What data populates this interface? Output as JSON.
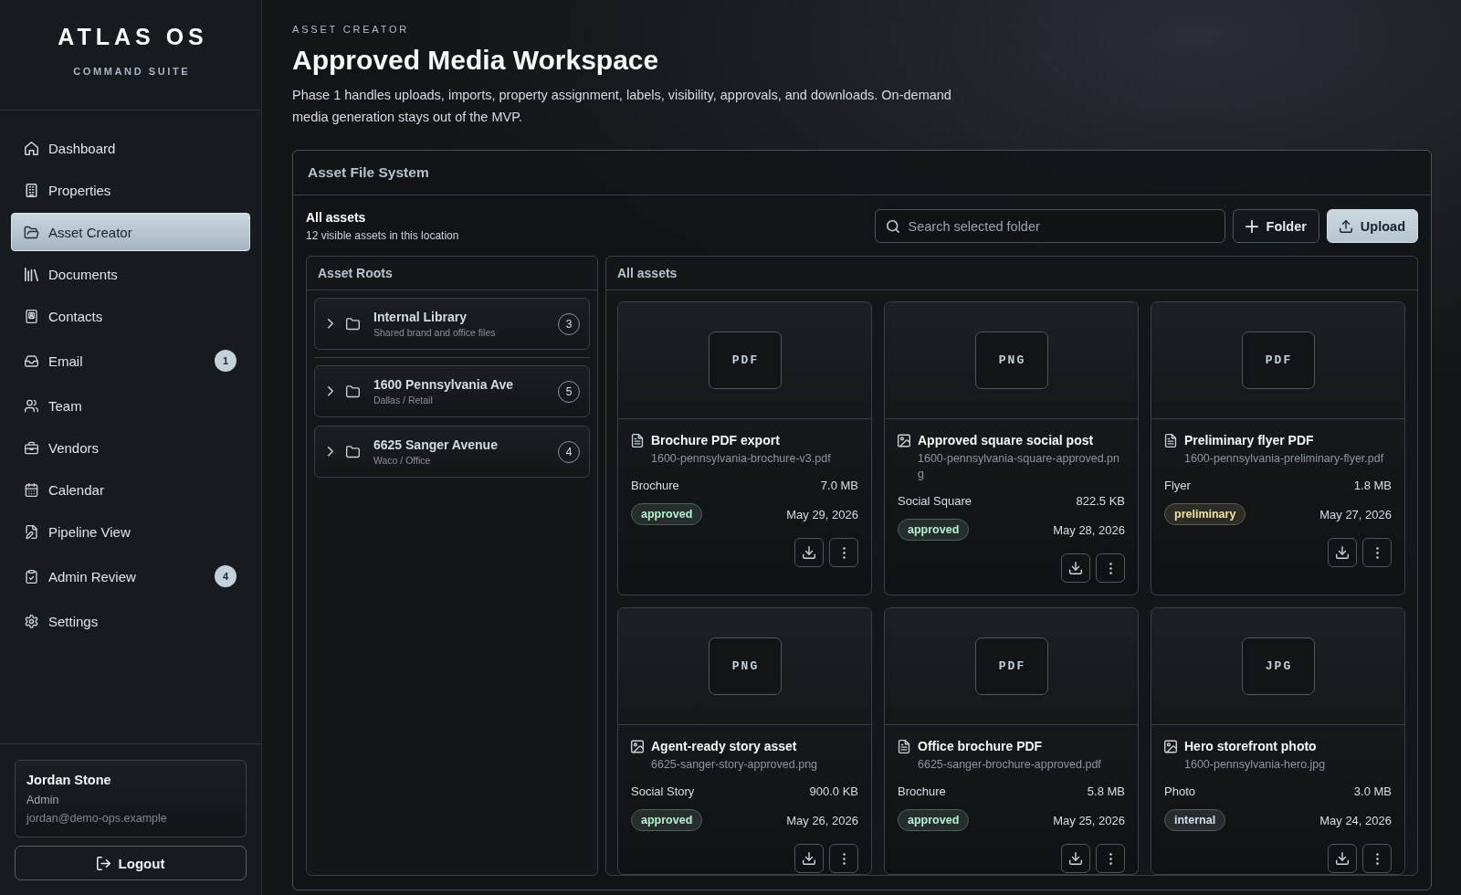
{
  "sidebar": {
    "brand": {
      "title": "ATLAS OS",
      "subtitle": "COMMAND SUITE"
    },
    "nav_items": [
      {
        "label": "Dashboard",
        "selected": false
      },
      {
        "label": "Properties",
        "selected": false
      },
      {
        "label": "Asset Creator",
        "selected": true
      },
      {
        "label": "Documents",
        "selected": false
      },
      {
        "label": "Contacts",
        "selected": false
      },
      {
        "label": "Email",
        "selected": false,
        "badge": "1"
      },
      {
        "label": "Team",
        "selected": false
      },
      {
        "label": "Vendors",
        "selected": false
      },
      {
        "label": "Calendar",
        "selected": false
      },
      {
        "label": "Pipeline View",
        "selected": false
      },
      {
        "label": "Admin Review",
        "selected": false,
        "badge": "4"
      },
      {
        "label": "Settings",
        "selected": false
      }
    ],
    "user": {
      "name": "Jordan Stone",
      "role": "Admin",
      "email": "jordan@demo-ops.example"
    },
    "logout_button": {
      "label": "Logout"
    }
  },
  "header": {
    "eyebrow": "ASSET CREATOR",
    "title": "Approved Media Workspace",
    "description": "Phase 1 handles uploads, imports, property assignment, labels, visibility, approvals, and downloads. On-demand media generation stays out of the MVP."
  },
  "file_system": {
    "title": "Asset File System",
    "location": {
      "title": "All assets",
      "subtitle": "12 visible assets in this location"
    },
    "search": {
      "placeholder": "Search selected folder"
    },
    "buttons": [
      {
        "label": "Folder",
        "kind": "create",
        "primary": false
      },
      {
        "label": "Upload",
        "kind": "upload",
        "primary": true
      }
    ],
    "roots": {
      "title": "Asset Roots",
      "groups": [
        {
          "items": [
            {
              "name": "Internal Library",
              "subtitle": "Shared brand and office files",
              "count": "3",
              "expanded": false
            }
          ]
        },
        {
          "items": [
            {
              "name": "1600 Pennsylvania Ave",
              "subtitle": "Dallas / Retail",
              "count": "5",
              "expanded": false
            },
            {
              "name": "6625 Sanger Avenue",
              "subtitle": "Waco / Office",
              "count": "4",
              "expanded": false
            }
          ]
        }
      ]
    },
    "assets": {
      "title": "All assets",
      "items": [
        {
          "format": "PDF",
          "kind": "document",
          "title": "Brochure PDF export",
          "filename": "1600-pennsylvania-brochure-v3.pdf",
          "category": "Brochure",
          "size": "7.0 MB",
          "status": {
            "label": "approved",
            "color": "#b6eed0"
          },
          "date": "May 29, 2026"
        },
        {
          "format": "PNG",
          "kind": "image",
          "title": "Approved square social post",
          "filename": "1600-pennsylvania-square-approved.png",
          "category": "Social Square",
          "size": "822.5 KB",
          "status": {
            "label": "approved",
            "color": "#b6eed0"
          },
          "date": "May 28, 2026"
        },
        {
          "format": "PDF",
          "kind": "document",
          "title": "Preliminary flyer PDF",
          "filename": "1600-pennsylvania-preliminary-flyer.pdf",
          "category": "Flyer",
          "size": "1.8 MB",
          "status": {
            "label": "preliminary",
            "color": "#f2e2a2"
          },
          "date": "May 27, 2026"
        },
        {
          "format": "PNG",
          "kind": "image",
          "title": "Agent-ready story asset",
          "filename": "6625-sanger-story-approved.png",
          "category": "Social Story",
          "size": "900.0 KB",
          "status": {
            "label": "approved",
            "color": "#b6eed0"
          },
          "date": "May 26, 2026"
        },
        {
          "format": "PDF",
          "kind": "document",
          "title": "Office brochure PDF",
          "filename": "6625-sanger-brochure-approved.pdf",
          "category": "Brochure",
          "size": "5.8 MB",
          "status": {
            "label": "approved",
            "color": "#b6eed0"
          },
          "date": "May 25, 2026"
        },
        {
          "format": "JPG",
          "kind": "image",
          "title": "Hero storefront photo",
          "filename": "1600-pennsylvania-hero.jpg",
          "category": "Photo",
          "size": "3.0 MB",
          "status": {
            "label": "internal",
            "color": "#d2ddeb"
          },
          "date": "May 24, 2026"
        }
      ]
    }
  }
}
